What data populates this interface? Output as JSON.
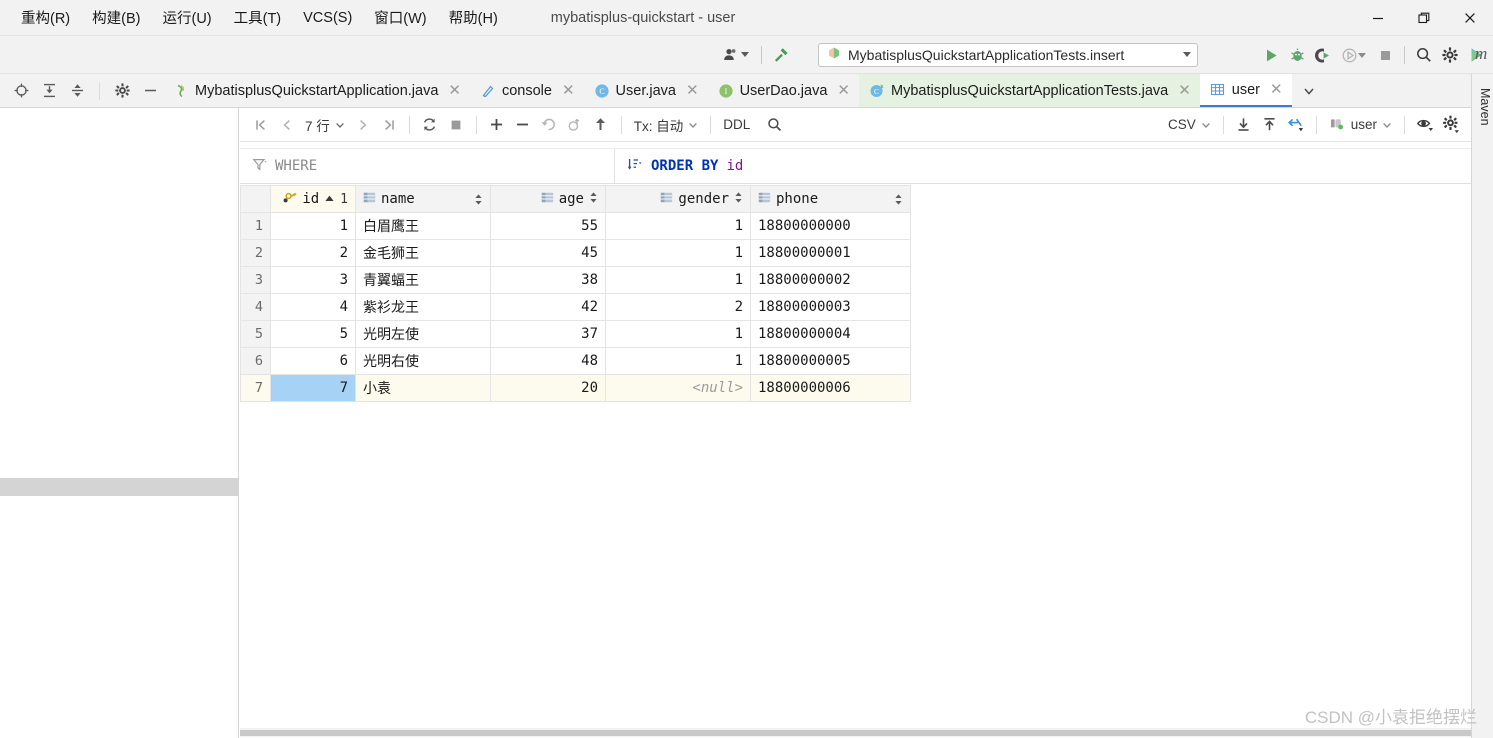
{
  "window": {
    "title": "mybatisplus-quickstart - user",
    "menus": [
      {
        "label": "重构(R)",
        "mnemonic": "R"
      },
      {
        "label": "构建(B)",
        "mnemonic": "B"
      },
      {
        "label": "运行(U)",
        "mnemonic": "U"
      },
      {
        "label": "工具(T)",
        "mnemonic": "T"
      },
      {
        "label": "VCS(S)",
        "mnemonic": "S"
      },
      {
        "label": "窗口(W)",
        "mnemonic": "W"
      },
      {
        "label": "帮助(H)",
        "mnemonic": "H"
      }
    ],
    "controls": {
      "minimize": "minimize-icon",
      "maximize": "restore-icon",
      "close": "close-icon"
    }
  },
  "navbar": {
    "run_config": "MybatisplusQuickstartApplicationTests.insert",
    "left_icons": [
      "user-profile-icon",
      "hammer-build-icon"
    ],
    "right_icons": [
      "run-icon",
      "debug-icon",
      "run-with-coverage-icon",
      "profiler-icon",
      "stop-icon",
      "search-everywhere-icon",
      "settings-icon",
      "ide-features-icon"
    ]
  },
  "editor_tabs": {
    "left_icons": [
      "locate-icon",
      "expand-all-icon",
      "collapse-all-icon",
      "settings-icon",
      "hide-icon"
    ],
    "tabs": [
      {
        "label": "MybatisplusQuickstartApplication.java",
        "icon": "java-springboot-icon",
        "state": "inactive"
      },
      {
        "label": "console",
        "icon": "console-icon",
        "state": "inactive"
      },
      {
        "label": "User.java",
        "icon": "java-class-icon",
        "state": "inactive"
      },
      {
        "label": "UserDao.java",
        "icon": "java-interface-icon",
        "state": "inactive"
      },
      {
        "label": "MybatisplusQuickstartApplicationTests.java",
        "icon": "java-test-class-icon",
        "state": "active-green"
      },
      {
        "label": "user",
        "icon": "db-table-icon",
        "state": "active"
      }
    ],
    "overflow": "chevron-down-icon"
  },
  "db_toolbar": {
    "first_page": "first-page-icon",
    "prev_page": "prev-page-icon",
    "rows_label": "7 行",
    "next_page": "next-page-icon",
    "last_page": "last-page-icon",
    "reload": "reload-icon",
    "cancel": "stop-icon",
    "add_row": "add-row-icon",
    "delete_row": "delete-row-icon",
    "revert": "revert-icon",
    "revert_selected": "revert-selected-icon",
    "submit": "submit-icon",
    "tx_label": "Tx: 自动",
    "ddl_label": "DDL",
    "search_icon": "search-icon",
    "format_label": "CSV",
    "export_icon": "export-data-icon",
    "import_icon": "import-data-icon",
    "jump_icon": "jump-to-console-icon",
    "session_label": "user",
    "session_icon": "db-session-icon",
    "view_icon": "eye-view-options-icon",
    "settings_icon": "gear-settings-icon"
  },
  "filter": {
    "where_icon": "filter-icon",
    "where_label": "WHERE",
    "order_icon": "sort-icon",
    "order_keyword": "ORDER BY",
    "order_column": "id",
    "close_icon": "close-icon"
  },
  "grid": {
    "row_header": "",
    "columns": [
      {
        "name": "id",
        "icon": "primary-key-icon",
        "sorted": "asc",
        "sort_order": "1",
        "align": "right",
        "is_pk": true
      },
      {
        "name": "name",
        "icon": "column-icon",
        "align": "left",
        "is_pk": false
      },
      {
        "name": "age",
        "icon": "column-icon",
        "align": "right",
        "is_pk": false
      },
      {
        "name": "gender",
        "icon": "column-icon",
        "align": "right",
        "is_pk": false
      },
      {
        "name": "phone",
        "icon": "column-icon",
        "align": "left",
        "is_pk": false
      }
    ],
    "rows": [
      {
        "n": "1",
        "id": "1",
        "name": "白眉鹰王",
        "age": "55",
        "gender": "1",
        "phone": "18800000000"
      },
      {
        "n": "2",
        "id": "2",
        "name": "金毛狮王",
        "age": "45",
        "gender": "1",
        "phone": "18800000001"
      },
      {
        "n": "3",
        "id": "3",
        "name": "青翼蝠王",
        "age": "38",
        "gender": "1",
        "phone": "18800000002"
      },
      {
        "n": "4",
        "id": "4",
        "name": "紫衫龙王",
        "age": "42",
        "gender": "2",
        "phone": "18800000003"
      },
      {
        "n": "5",
        "id": "5",
        "name": "光明左使",
        "age": "37",
        "gender": "1",
        "phone": "18800000004"
      },
      {
        "n": "6",
        "id": "6",
        "name": "光明右使",
        "age": "48",
        "gender": "1",
        "phone": "18800000005"
      },
      {
        "n": "7",
        "id": "7",
        "name": "小袁",
        "age": "20",
        "gender": "<null>",
        "phone": "18800000006",
        "selected": true,
        "gender_null": true
      }
    ]
  },
  "right_sidebar": {
    "label": "Maven",
    "m_glyph": "m"
  },
  "watermark": "CSDN @小袁拒绝摆烂",
  "colors": {
    "accent_blue": "#3d7bd6",
    "selection": "#a6d2f5",
    "pk_row": "#fcfbee",
    "tab_green": "#e5f2e1",
    "keyword": "#0033b3",
    "identifier": "#871094"
  }
}
